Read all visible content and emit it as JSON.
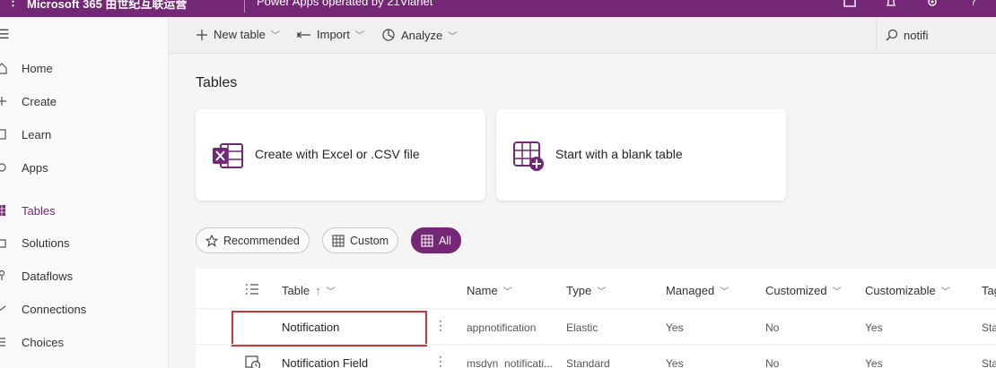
{
  "topbar": {
    "app_title": "Microsoft 365 由世纪互联运营",
    "env_title": "Power Apps operated by 21Vianet"
  },
  "sidebar": {
    "items": [
      {
        "label": "Home",
        "icon": "home-icon"
      },
      {
        "label": "Create",
        "icon": "plus-icon"
      },
      {
        "label": "Learn",
        "icon": "book-icon"
      },
      {
        "label": "Apps",
        "icon": "apps-icon"
      },
      {
        "label": "Tables",
        "icon": "table-icon",
        "selected": true
      },
      {
        "label": "Solutions",
        "icon": "solutions-icon"
      },
      {
        "label": "Dataflows",
        "icon": "dataflow-icon"
      },
      {
        "label": "Connections",
        "icon": "connection-icon"
      },
      {
        "label": "Choices",
        "icon": "list-icon"
      }
    ]
  },
  "commandbar": {
    "new_table": "New table",
    "import": "Import",
    "analyze": "Analyze",
    "search_value": "notifi"
  },
  "page": {
    "title": "Tables",
    "cards": [
      {
        "label": "Create with Excel or .CSV file",
        "icon": "excel-icon"
      },
      {
        "label": "Start with a blank table",
        "icon": "blank-table-icon"
      }
    ],
    "filters": [
      {
        "label": "Recommended",
        "icon": "star-icon"
      },
      {
        "label": "Custom",
        "icon": "custom-table-icon"
      },
      {
        "label": "All",
        "icon": "grid-icon",
        "active": true
      }
    ]
  },
  "grid": {
    "columns": [
      "Table",
      "Name",
      "Type",
      "Managed",
      "Customized",
      "Customizable",
      "Tag"
    ],
    "sort_indicator": "↑",
    "rows": [
      {
        "table": "Notification",
        "name": "appnotification",
        "type": "Elastic",
        "managed": "Yes",
        "customized": "No",
        "customizable": "Yes",
        "tag": "Sta"
      },
      {
        "table": "Notification Field",
        "name": "msdyn_notificati...",
        "type": "Standard",
        "managed": "Yes",
        "customized": "No",
        "customizable": "Yes",
        "tag": "Sta"
      }
    ]
  },
  "colors": {
    "brand": "#742774",
    "highlight": "#d13438"
  }
}
